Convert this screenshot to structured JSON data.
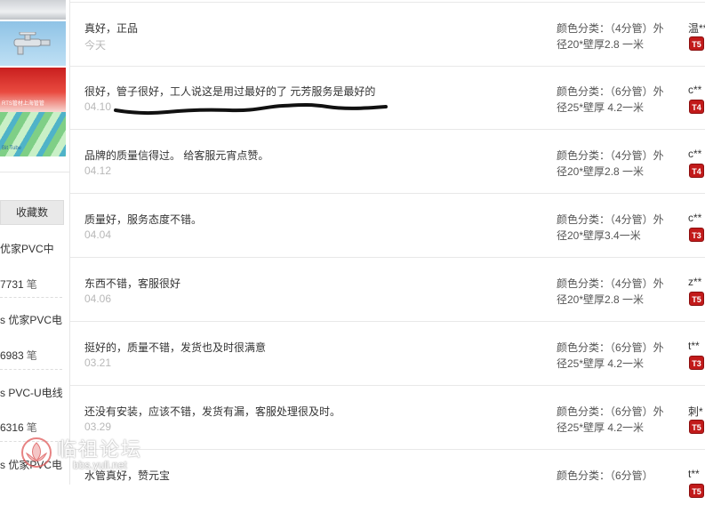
{
  "sidebar": {
    "thumbnail_captions": [
      "RTS管材上海管管",
      "Bit Tube"
    ],
    "favorites_button": "收藏数",
    "products": [
      {
        "name": "优家PVC中",
        "count": "7731",
        "unit": "笔"
      },
      {
        "name": "s 优家PVC电",
        "count": "6983",
        "unit": "笔"
      },
      {
        "name": "s PVC-U电线",
        "count": "6316",
        "unit": "笔"
      },
      {
        "name": "s 优家PVC电",
        "count": "",
        "unit": ""
      }
    ]
  },
  "reviews": [
    {
      "text": "真好，正品",
      "date": "今天",
      "spec_line1": "颜色分类：（4分管）外",
      "spec_line2": "径20*壁厚2.8 一米",
      "user": "温**",
      "badge": "T5"
    },
    {
      "text": "很好，管子很好，工人说这是用过最好的了 元芳服务是最好的",
      "date": "04.10",
      "spec_line1": "颜色分类：（6分管）外",
      "spec_line2": "径25*壁厚 4.2一米",
      "user": "c**",
      "badge": "T4"
    },
    {
      "text": "品牌的质量信得过。 给客服元宵点赞。",
      "date": "04.12",
      "spec_line1": "颜色分类：（4分管）外",
      "spec_line2": "径20*壁厚2.8 一米",
      "user": "c**",
      "badge": "T4"
    },
    {
      "text": "质量好，服务态度不错。",
      "date": "04.04",
      "spec_line1": "颜色分类：（4分管）外",
      "spec_line2": "径20*壁厚3.4一米",
      "user": "c**",
      "badge": "T3"
    },
    {
      "text": "东西不错，客服很好",
      "date": "04.06",
      "spec_line1": "颜色分类：（4分管）外",
      "spec_line2": "径20*壁厚2.8 一米",
      "user": "z**",
      "badge": "T5"
    },
    {
      "text": "挺好的，质量不错，发货也及时很满意",
      "date": "03.21",
      "spec_line1": "颜色分类：（6分管）外",
      "spec_line2": "径25*壁厚 4.2一米",
      "user": "t**",
      "badge": "T3"
    },
    {
      "text": "还没有安装，应该不错，发货有漏，客服处理很及时。",
      "date": "03.29",
      "spec_line1": "颜色分类：（6分管）外",
      "spec_line2": "径25*壁厚 4.2一米",
      "user": "刺*",
      "badge": "T5"
    },
    {
      "text": "水管真好，赞元宝",
      "date": "",
      "spec_line1": "颜色分类：（6分管）",
      "spec_line2": "",
      "user": "t**",
      "badge": "T5"
    }
  ],
  "watermark": {
    "title": "临祖论坛",
    "url": "bbs.yuli.net"
  }
}
